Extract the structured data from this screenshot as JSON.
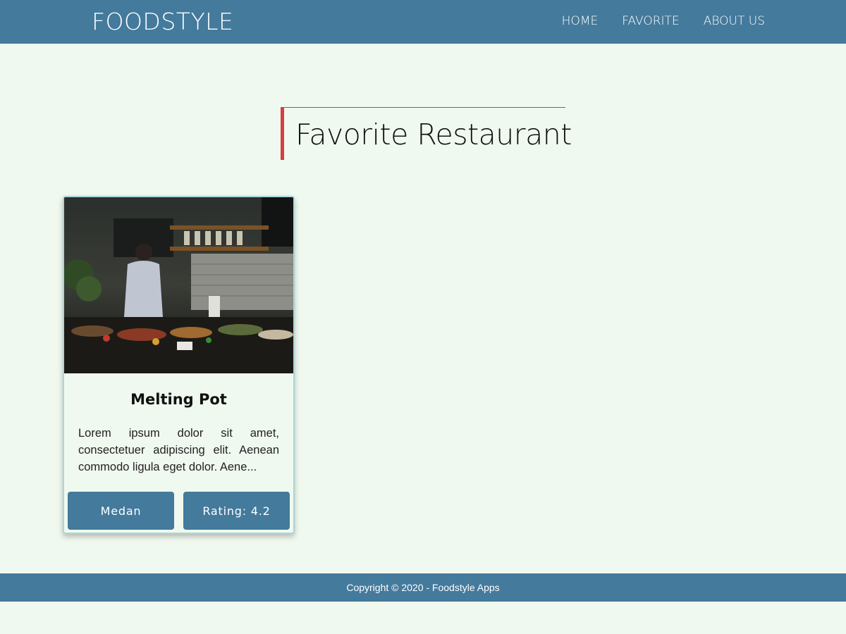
{
  "header": {
    "brand": "FOODSTYLE",
    "nav": [
      {
        "label": "HOME"
      },
      {
        "label": "FAVORITE"
      },
      {
        "label": "ABOUT US"
      }
    ]
  },
  "main": {
    "heading": "Favorite Restaurant",
    "restaurants": [
      {
        "name": "Melting Pot",
        "description": "Lorem ipsum dolor sit amet, consectetuer adipiscing elit. Aenean commodo ligula eget dolor. Aene...",
        "city": "Medan",
        "rating_label": "Rating: 4.2"
      }
    ]
  },
  "footer": {
    "copyright": "Copyright © 2020 - Foodstyle Apps"
  },
  "colors": {
    "primary": "#447a9c",
    "background": "#f0f9ef",
    "accent": "#d33e43",
    "card_border": "#a9d6da"
  }
}
